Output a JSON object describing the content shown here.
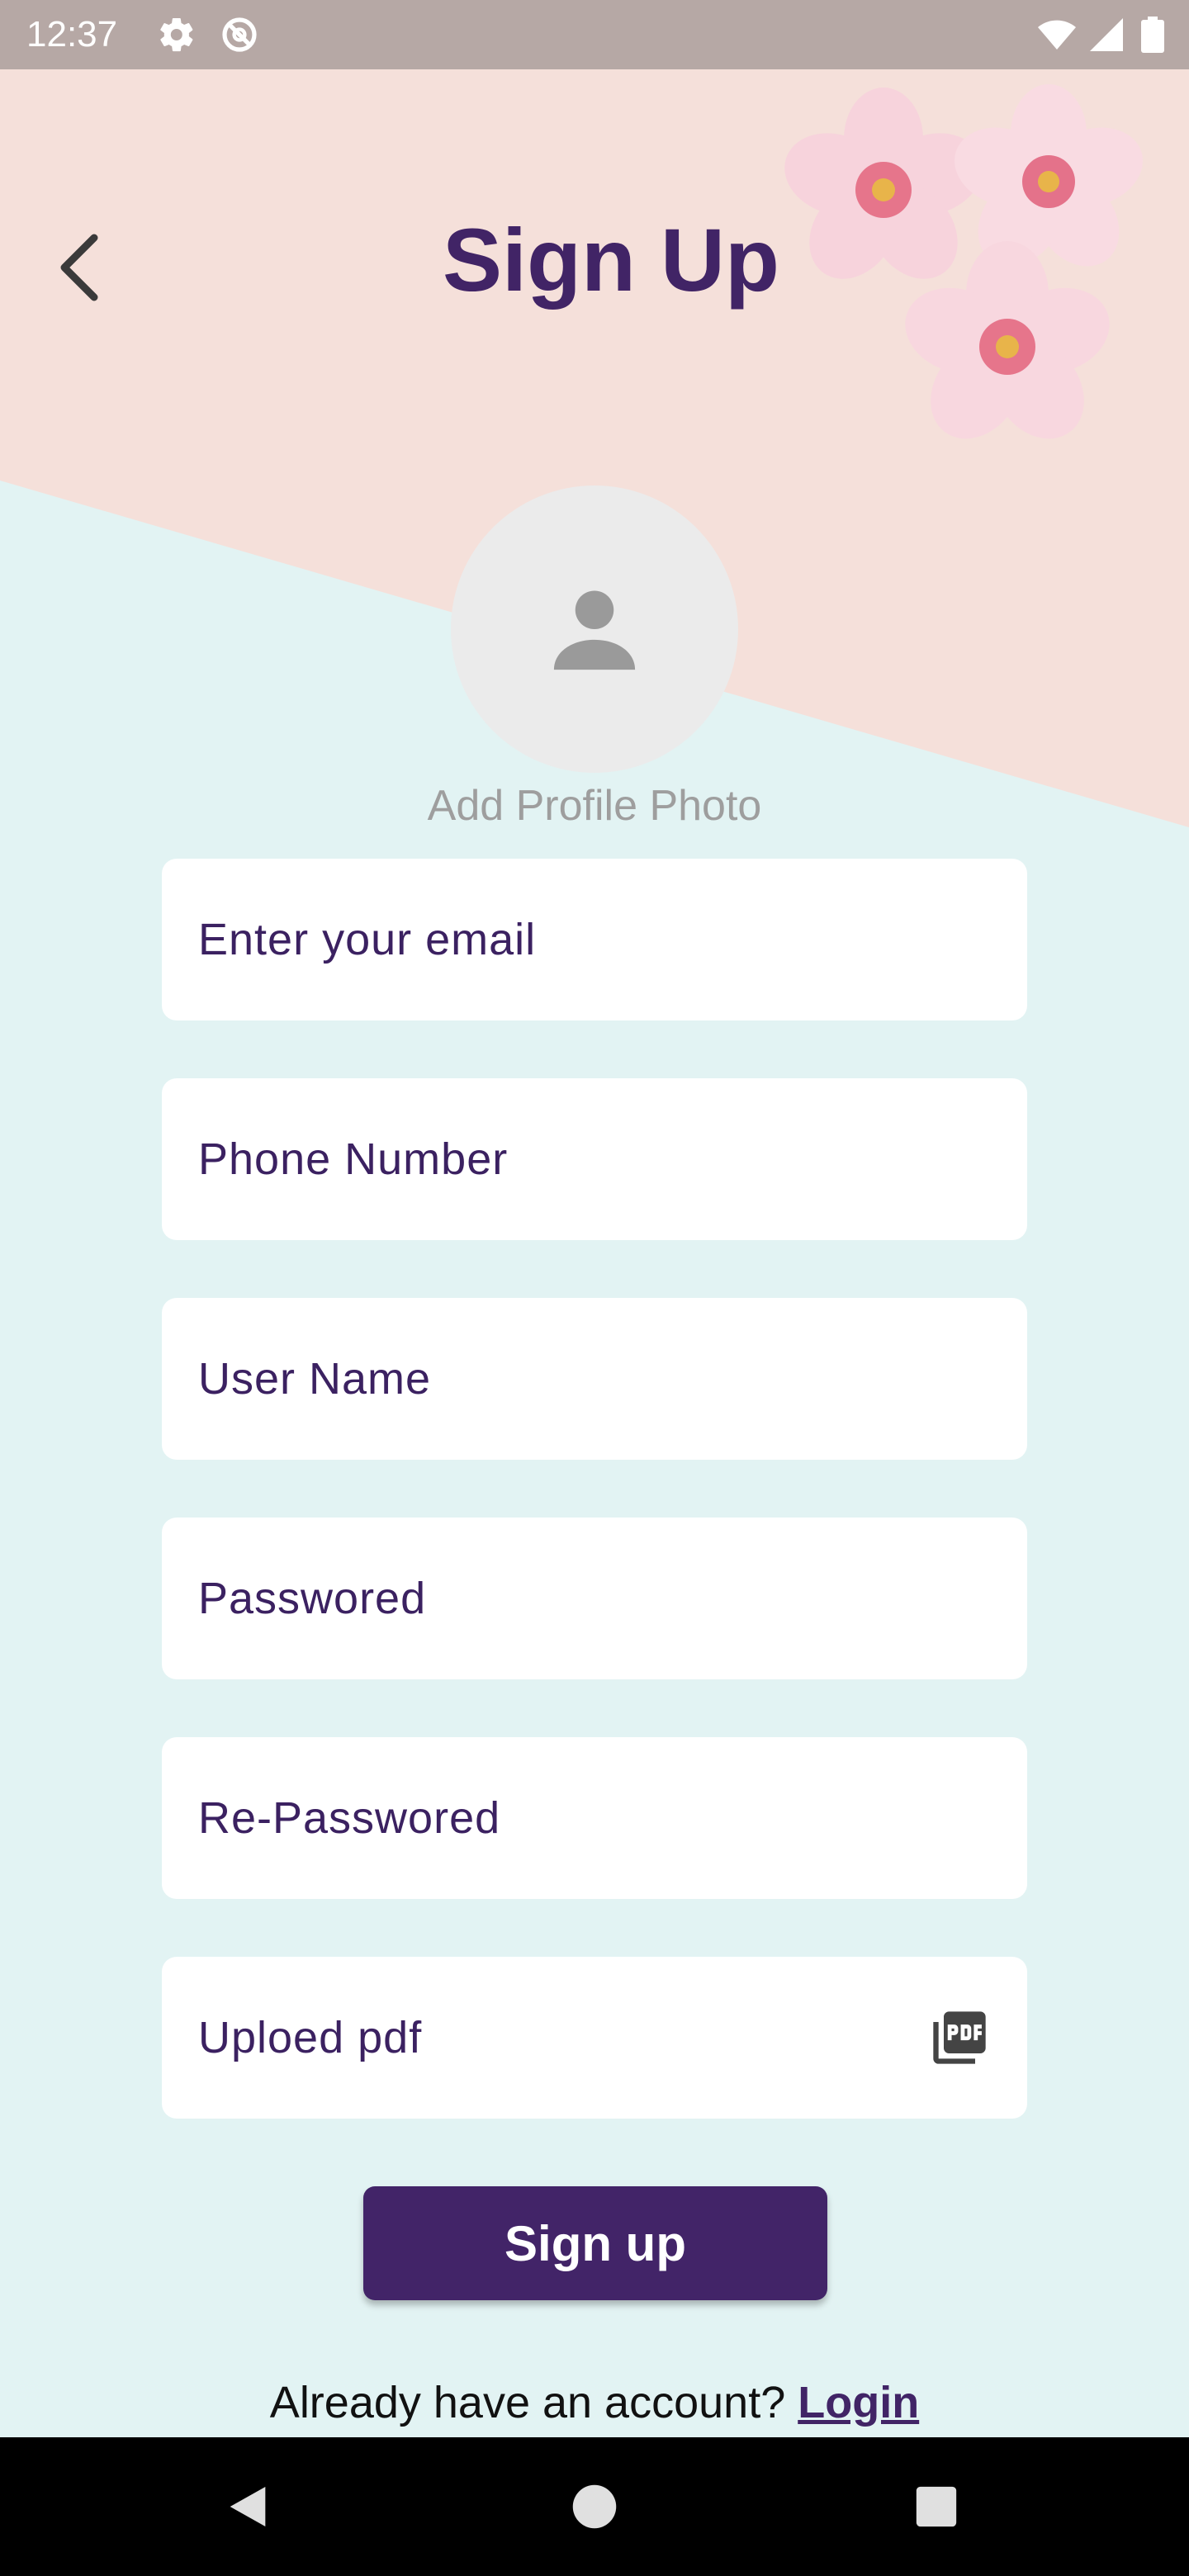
{
  "status_bar": {
    "time": "12:37",
    "icons": [
      "gear-icon",
      "no-disturb-icon",
      "wifi-icon",
      "signal-icon",
      "battery-icon"
    ]
  },
  "header": {
    "title": "Sign Up",
    "back_icon": "chevron-left-icon"
  },
  "profile": {
    "avatar_icon": "person-icon",
    "caption": "Add Profile Photo"
  },
  "form": {
    "fields": [
      {
        "label": "Enter your email"
      },
      {
        "label": "Phone Number"
      },
      {
        "label": "User Name"
      },
      {
        "label": "Passwored"
      },
      {
        "label": "Re-Passwored"
      },
      {
        "label": "Uploed pdf",
        "icon": "pdf-icon"
      }
    ],
    "submit_label": "Sign up"
  },
  "footer": {
    "prompt": "Already have an account? ",
    "login_label": "Login"
  },
  "nav_bar": {
    "icons": [
      "nav-back-icon",
      "nav-home-icon",
      "nav-recents-icon"
    ]
  },
  "colors": {
    "accent": "#412466",
    "top_background": "#f5e0da",
    "bottom_background": "#e2f3f3",
    "status_bar": "#b6a8a5"
  }
}
